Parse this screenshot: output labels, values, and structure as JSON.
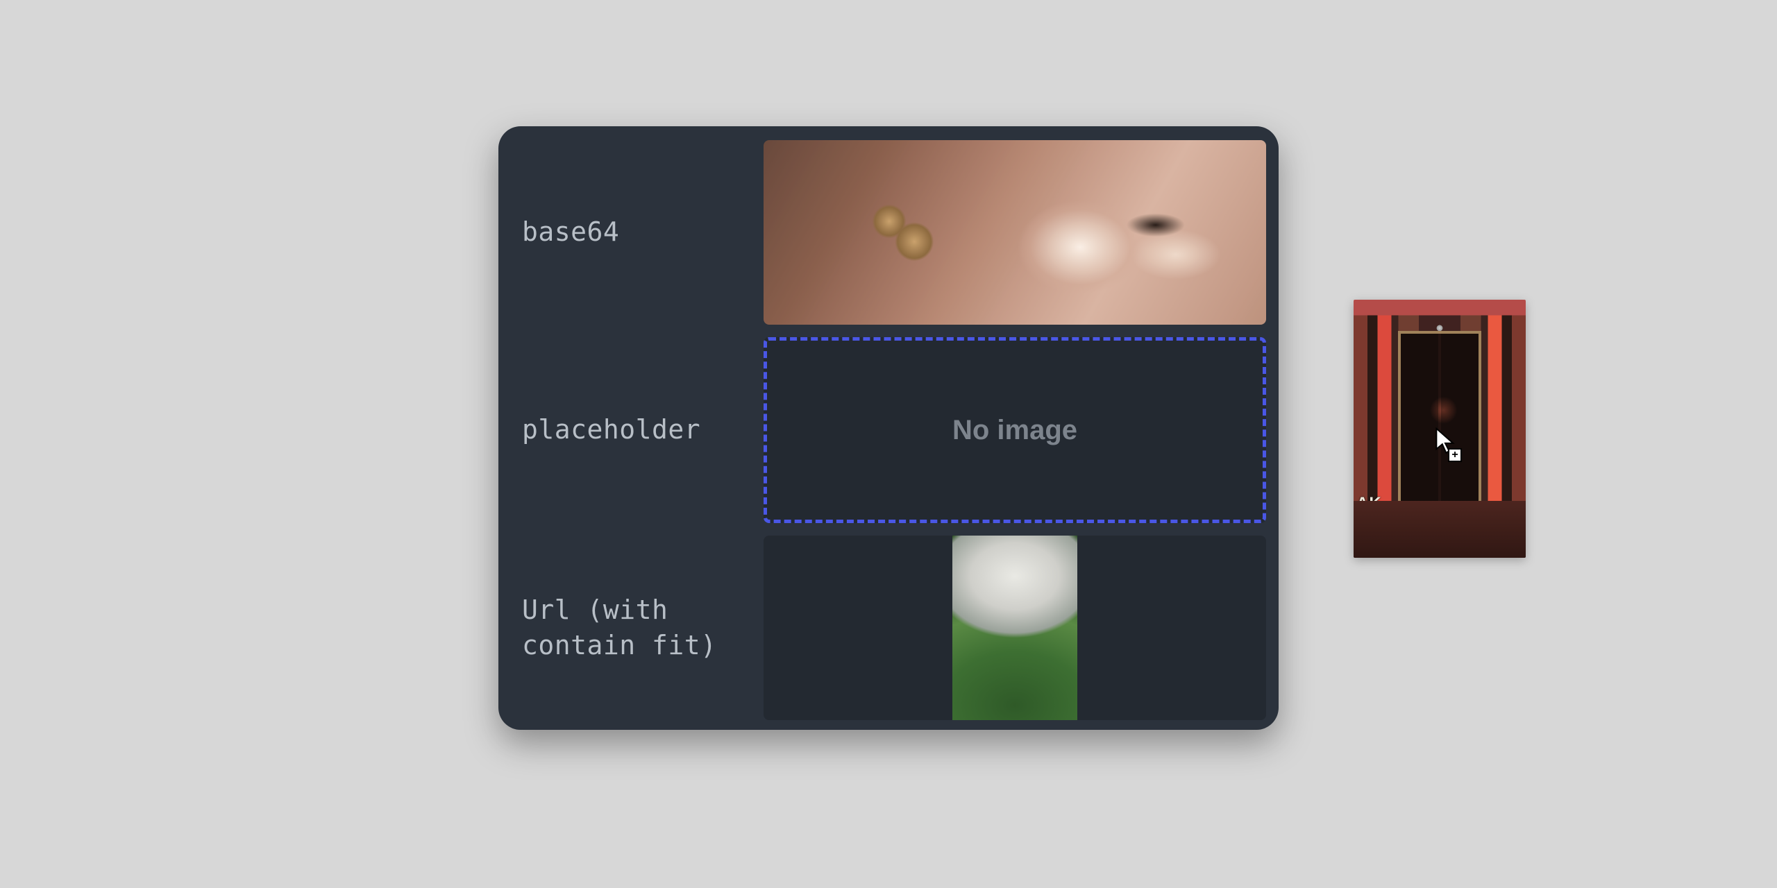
{
  "rows": [
    {
      "label": "base64",
      "kind": "image",
      "image_hint": "portrait-closeup"
    },
    {
      "label": "placeholder",
      "kind": "placeholder",
      "placeholder_text": "No image"
    },
    {
      "label": "Url (with contain fit)",
      "kind": "image-contain",
      "image_hint": "tower-in-greenery"
    }
  ],
  "drag": {
    "visible": true,
    "image_hint": "neon-storefront-doorway",
    "graffiti": "AK",
    "cursor_badge": "+"
  },
  "colors": {
    "page_bg": "#d7d7d7",
    "panel_bg": "#2b323c",
    "cell_bg": "#232931",
    "label_fg": "#b8bfc7",
    "placeholder_fg": "#7d848d",
    "dashed_border": "#4a57e6"
  }
}
